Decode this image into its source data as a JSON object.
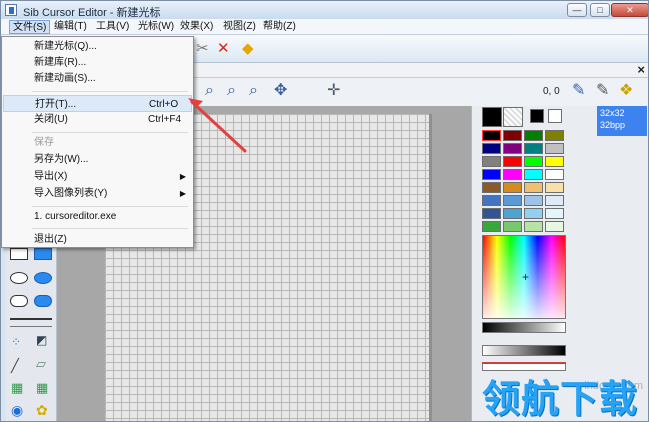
{
  "window": {
    "title": "Sib Cursor Editor - 新建光标"
  },
  "menu": {
    "items": [
      "文件(S)",
      "编辑(T)",
      "工具(V)",
      "光标(W)",
      "效果(X)",
      "视图(Z)",
      "帮助(Z)"
    ]
  },
  "file_menu": {
    "new_cursor": "新建光标(Q)...",
    "new_library": "新建库(R)...",
    "new_animation": "新建动画(S)...",
    "open": "打开(T)...",
    "open_shortcut": "Ctrl+O",
    "close": "关闭(U)",
    "close_shortcut": "Ctrl+F4",
    "save": "保存",
    "save_as": "另存为(W)...",
    "export": "导出(X)",
    "import_list": "导入图像列表(Y)",
    "recent": "1. cursoreditor.exe",
    "exit": "退出(Z)"
  },
  "editor": {
    "coordinates": "0, 0"
  },
  "image_info": {
    "size": "32x32",
    "depth": "32bpp"
  },
  "watermark": {
    "site": "lhdown.com",
    "brand": "领航下载"
  },
  "colors": {
    "accent": "#3d83ef",
    "arrow": "#e34040"
  }
}
